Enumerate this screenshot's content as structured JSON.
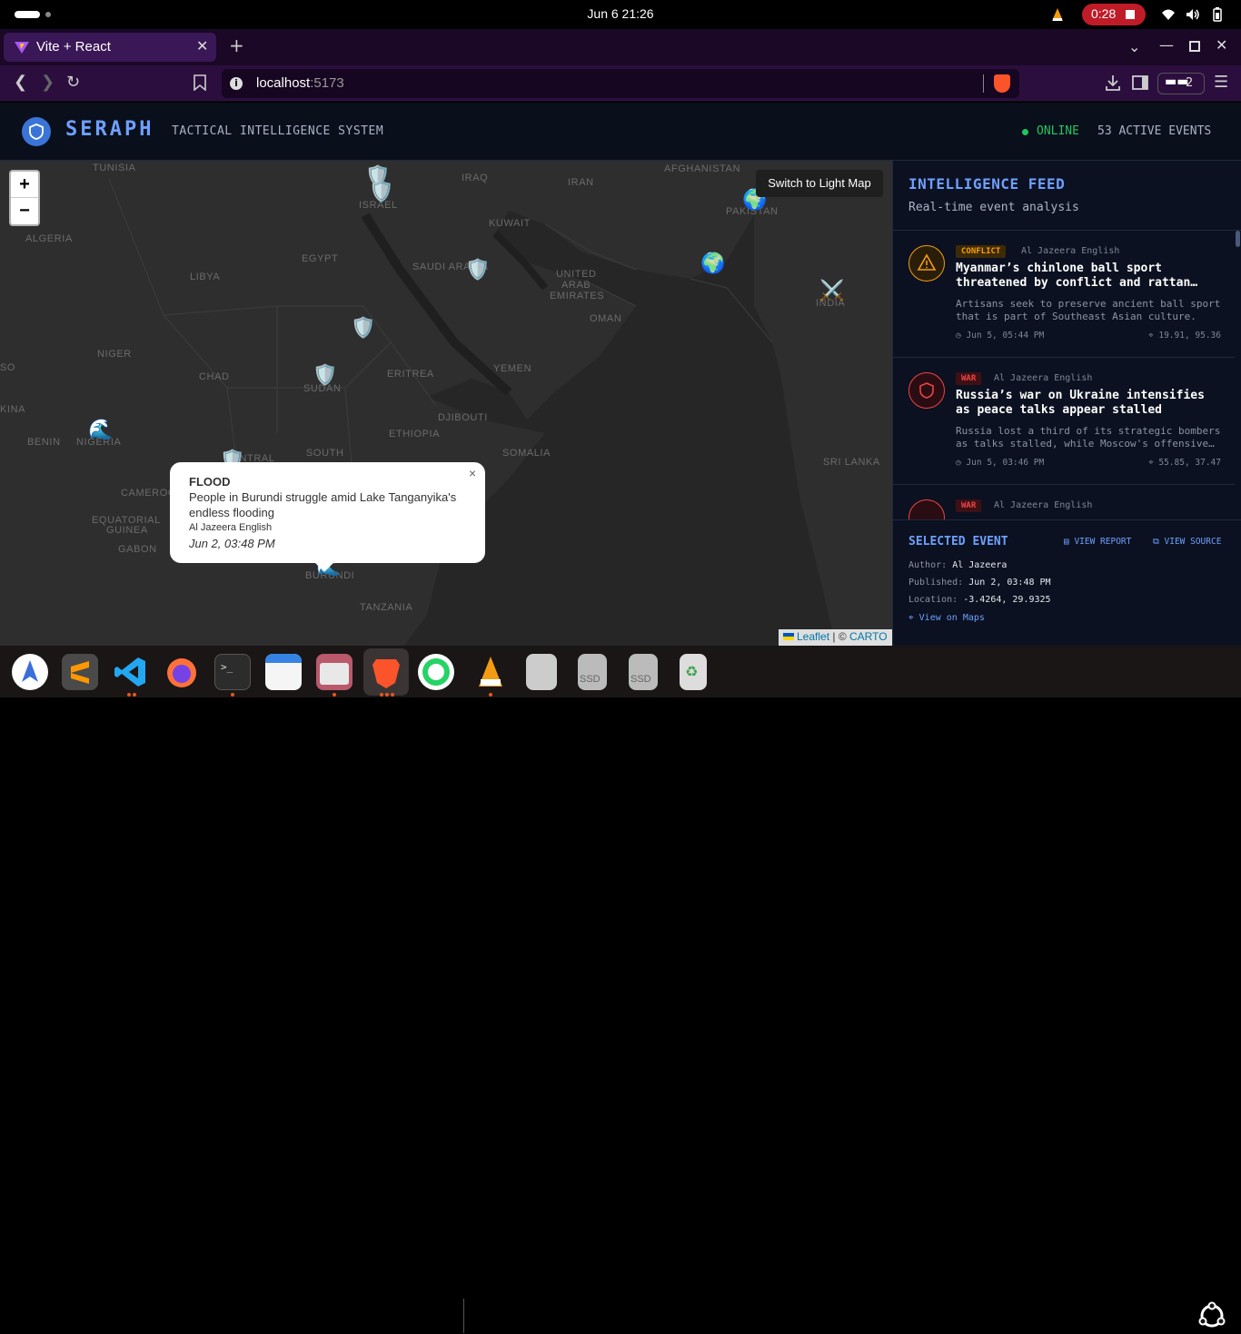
{
  "system": {
    "clock": "Jun 6  21:26",
    "recording_time": "0:28"
  },
  "browser": {
    "tab_title": "Vite + React",
    "url_host": "localhost",
    "url_port": ":5173",
    "wallet_count": "2"
  },
  "app": {
    "brand": "SERAPH",
    "subtitle": "TACTICAL INTELLIGENCE SYSTEM",
    "status": "ONLINE",
    "active_events": "53 ACTIVE EVENTS"
  },
  "map": {
    "switch_button": "Switch to Light Map",
    "zoom_in": "+",
    "zoom_out": "−",
    "attribution_leaflet": "Leaflet",
    "attribution_sep": " | © ",
    "attribution_carto": "CARTO",
    "countries": [
      "TUNISIA",
      "AFGHANISTAN",
      "IRAQ",
      "IRAN",
      "ISRAEL",
      "KUWAIT",
      "PAKISTAN",
      "ALGERIA",
      "EGYPT",
      "LIBYA",
      "SAUDI ARABIA",
      "UNITED",
      "ARAB",
      "EMIRATES",
      "OMAN",
      "INDIA",
      "NIGER",
      "CHAD",
      "SUDAN",
      "ERITREA",
      "YEMEN",
      "DJIBOUTI",
      "ETHIOPIA",
      "SOMALIA",
      "SRI LANKA",
      "NIGERIA",
      "BENIN",
      "KINA",
      "SO",
      "SOUTH",
      "CENTRAL",
      "CAMEROON",
      "EQUATORIAL",
      "GUINEA",
      "GABON",
      "BURUNDI",
      "TANZANIA"
    ],
    "popup": {
      "type": "FLOOD",
      "title": "People in Burundi struggle amid Lake Tanganyika's endless flooding",
      "source": "Al Jazeera English",
      "date": "Jun 2, 03:48 PM",
      "close": "×"
    }
  },
  "feed": {
    "title": "INTELLIGENCE FEED",
    "subtitle": "Real-time event analysis",
    "items": [
      {
        "category": "CONFLICT",
        "source": "Al Jazeera English",
        "title": "Myanmar’s chinlone ball sport threatened by conflict and rattan shortage",
        "description": "Artisans seek to preserve ancient ball sport that is part of Southeast Asian culture.",
        "time": "Jun 5, 05:44 PM",
        "coords": "19.91, 95.36",
        "color": "#f59e0b"
      },
      {
        "category": "WAR",
        "source": "Al Jazeera English",
        "title": "Russia’s war on Ukraine intensifies as peace talks appear stalled",
        "description": "Russia lost a third of its strategic bombers as talks stalled, while Moscow's offensive continues.",
        "time": "Jun 5, 03:46 PM",
        "coords": "55.85, 37.47",
        "color": "#ef4444"
      },
      {
        "category": "WAR",
        "source": "Al Jazeera English",
        "title": "",
        "description": "",
        "time": "",
        "coords": "",
        "color": "#ef4444"
      }
    ]
  },
  "selected": {
    "title": "SELECTED EVENT",
    "view_report": "VIEW REPORT",
    "view_source": "VIEW SOURCE",
    "author_label": "Author:",
    "author": "Al Jazeera",
    "published_label": "Published:",
    "published": "Jun 2, 03:48 PM",
    "location_label": "Location:",
    "location": "-3.4264, 29.9325",
    "maps_link": "View on Maps"
  },
  "dock": {
    "apps": [
      "app-center",
      "sublime-text",
      "vscode",
      "firefox",
      "terminal",
      "calendar",
      "files",
      "brave",
      "whatsapp",
      "vlc",
      "disks",
      "ssd-drive-1",
      "ssd-drive-2",
      "trash"
    ],
    "drive_label": "SSD"
  }
}
